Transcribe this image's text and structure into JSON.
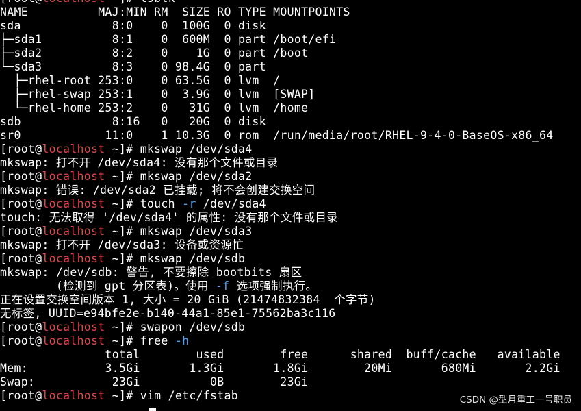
{
  "terminal": {
    "prompt": {
      "open": "[",
      "user": "root",
      "at": "@",
      "host": "localhost",
      "rest": " ~]# "
    },
    "lines": [
      {
        "kind": "prompt",
        "cmd": "lsblk"
      },
      {
        "kind": "text",
        "text": "NAME          MAJ:MIN RM  SIZE RO TYPE MOUNTPOINTS"
      },
      {
        "kind": "text",
        "text": "sda             8:0    0  100G  0 disk"
      },
      {
        "kind": "text",
        "text": "├─sda1          8:1    0  600M  0 part /boot/efi"
      },
      {
        "kind": "text",
        "text": "├─sda2          8:2    0    1G  0 part /boot"
      },
      {
        "kind": "text",
        "text": "└─sda3          8:3    0 98.4G  0 part"
      },
      {
        "kind": "text",
        "text": "  ├─rhel-root 253:0    0 63.5G  0 lvm  /"
      },
      {
        "kind": "text",
        "text": "  ├─rhel-swap 253:1    0  3.9G  0 lvm  [SWAP]"
      },
      {
        "kind": "text",
        "text": "  └─rhel-home 253:2    0   31G  0 lvm  /home"
      },
      {
        "kind": "text",
        "text": "sdb             8:16   0   20G  0 disk"
      },
      {
        "kind": "text",
        "text": "sr0            11:0    1 10.3G  0 rom  /run/media/root/RHEL-9-4-0-BaseOS-x86_64"
      },
      {
        "kind": "prompt",
        "cmd": "mkswap /dev/sda4"
      },
      {
        "kind": "text",
        "text": "mkswap: 打不开 /dev/sda4: 没有那个文件或目录"
      },
      {
        "kind": "prompt",
        "cmd": "mkswap /dev/sda2"
      },
      {
        "kind": "text",
        "text": "mkswap: 错误: /dev/sda2 已挂载; 将不会创建交换空间"
      },
      {
        "kind": "prompt",
        "cmd": "touch ",
        "flag": "-r",
        "cmd_after": " /dev/sda4"
      },
      {
        "kind": "text",
        "text": "touch: 无法取得 '/dev/sda4' 的属性: 没有那个文件或目录"
      },
      {
        "kind": "prompt",
        "cmd": "mkswap /dev/sda3"
      },
      {
        "kind": "text",
        "text": "mkswap: 打不开 /dev/sda3: 设备或资源忙"
      },
      {
        "kind": "prompt",
        "cmd": "mkswap /dev/sdb"
      },
      {
        "kind": "text",
        "text": "mkswap: /dev/sdb: 警告, 不要擦除 bootbits 扇区"
      },
      {
        "kind": "text",
        "text": "        (检测到 gpt 分区表)。使用 ",
        "flag": "-f",
        "text_after": " 选项强制执行。"
      },
      {
        "kind": "text",
        "text": "正在设置交换空间版本 1, 大小 = 20 GiB (21474832384  个字节)"
      },
      {
        "kind": "text",
        "text": "无标签, UUID=e94bfe2e-b140-44a1-85e1-75562ba3c116"
      },
      {
        "kind": "prompt",
        "cmd": "swapon /dev/sdb"
      },
      {
        "kind": "prompt",
        "cmd": "free ",
        "flag": "-h"
      },
      {
        "kind": "text",
        "text": "               total        used        free      shared  buff/cache   available"
      },
      {
        "kind": "text",
        "text": "Mem:           3.5Gi       1.3Gi       1.8Gi        20Mi       680Mi       2.2Gi"
      },
      {
        "kind": "text",
        "text": "Swap:           23Gi          0B        23Gi"
      },
      {
        "kind": "prompt",
        "cmd": "vim /etc/fstab"
      }
    ]
  },
  "watermark": {
    "text": "CSDN @型月重工一号职员"
  },
  "colors": {
    "background": "#000000",
    "foreground": "#ffffff",
    "host": "#e3444c",
    "flag": "#4aa0f0"
  }
}
